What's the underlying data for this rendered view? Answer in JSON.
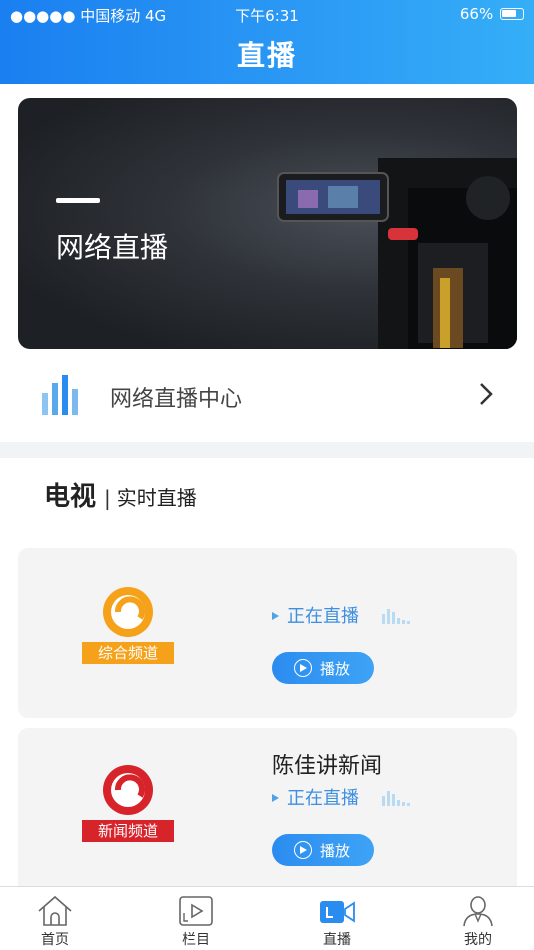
{
  "status_bar": {
    "carrier": "●●●●● 中国移动  4G",
    "time": "下午6:31",
    "battery": "66%"
  },
  "header": {
    "title": "直播"
  },
  "banner": {
    "title": "网络直播"
  },
  "live_center": {
    "label": "网络直播中心"
  },
  "tv": {
    "heading": "电视",
    "separator": "|",
    "subheading": "实时直播"
  },
  "channels": [
    {
      "logo_text": "综合频道",
      "show_name": "",
      "status": "正在直播",
      "play_label": "播放",
      "logo_color": "#f6a11a"
    },
    {
      "logo_text": "新闻频道",
      "show_name": "陈佳讲新闻",
      "status": "正在直播",
      "play_label": "播放",
      "logo_color": "#d7232a"
    }
  ],
  "tabbar": {
    "items": [
      {
        "label": "首页",
        "icon": "home-icon"
      },
      {
        "label": "栏目",
        "icon": "columns-icon"
      },
      {
        "label": "直播",
        "icon": "live-icon",
        "active": true
      },
      {
        "label": "我的",
        "icon": "profile-icon"
      }
    ]
  },
  "colors": {
    "accent": "#2b8cf0",
    "live_text": "#3d8fe0"
  }
}
